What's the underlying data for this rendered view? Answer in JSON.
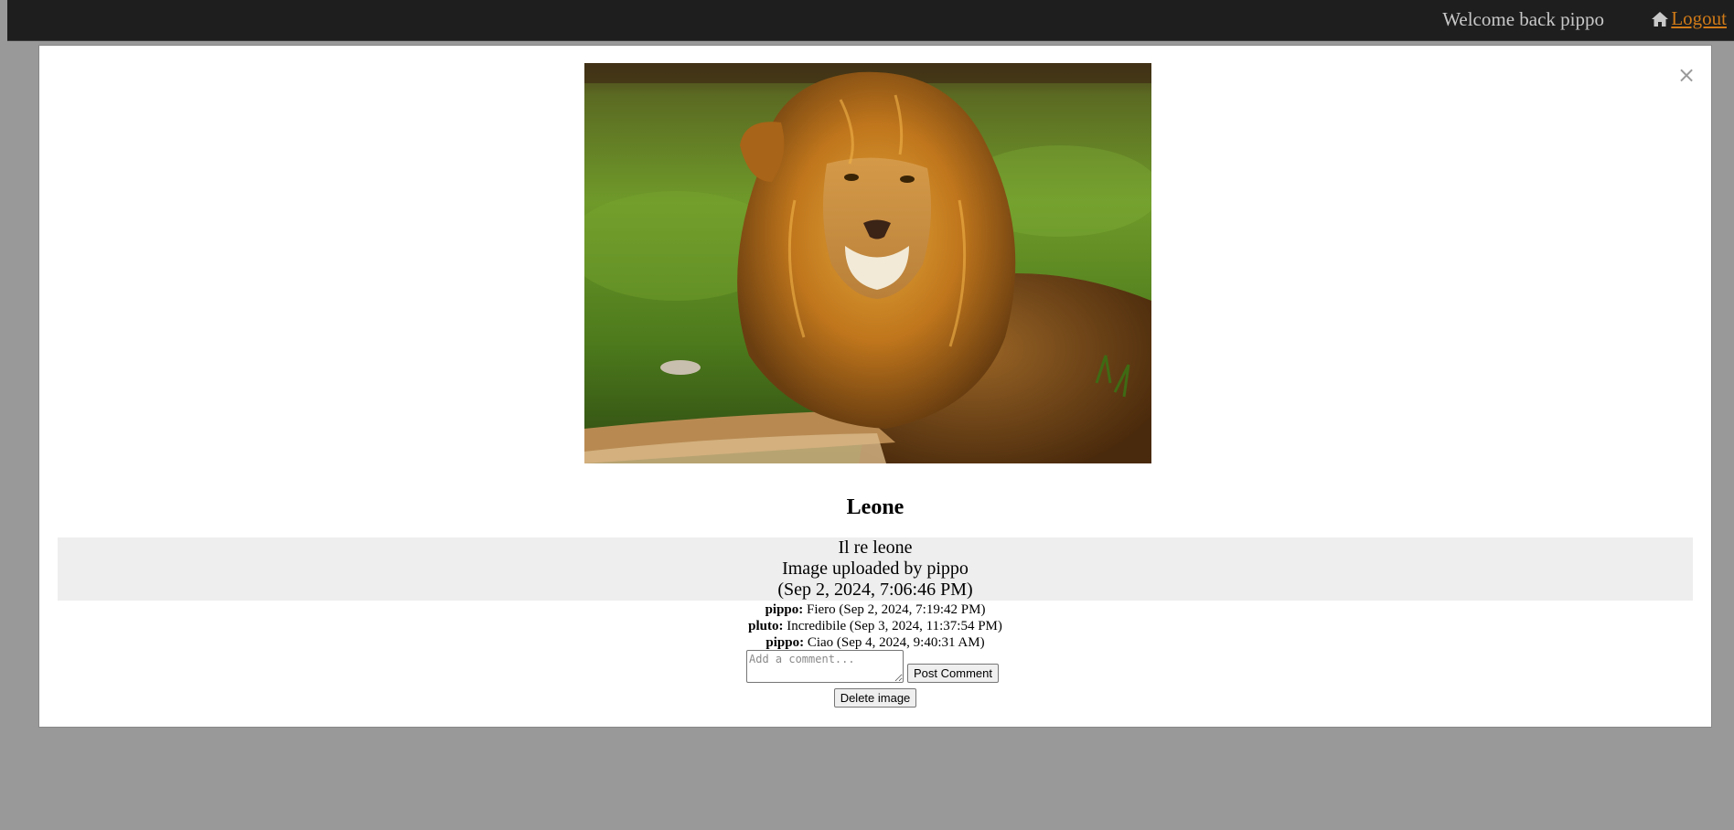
{
  "topbar": {
    "welcome_text": "Welcome back pippo",
    "logout_label": "Logout",
    "link_color": "#d07a18",
    "home_icon": "home-icon"
  },
  "modal": {
    "close_symbol": "×",
    "close_icon": "close-icon",
    "image_subject": "lion",
    "title": "Leone",
    "description": "Il re leone",
    "uploaded_by": "Image uploaded by pippo",
    "uploaded_date": "(Sep 2, 2024, 7:06:46 PM)",
    "comments": [
      {
        "author": "pippo:",
        "text": "Fiero (Sep 2, 2024, 7:19:42 PM)"
      },
      {
        "author": "pluto:",
        "text": "Incredibile (Sep 3, 2024, 11:37:54 PM)"
      },
      {
        "author": "pippo:",
        "text": "Ciao (Sep 4, 2024, 9:40:31 AM)"
      }
    ],
    "comment_placeholder": "Add a comment...",
    "comment_value": "",
    "post_label": "Post Comment",
    "delete_label": "Delete image"
  }
}
